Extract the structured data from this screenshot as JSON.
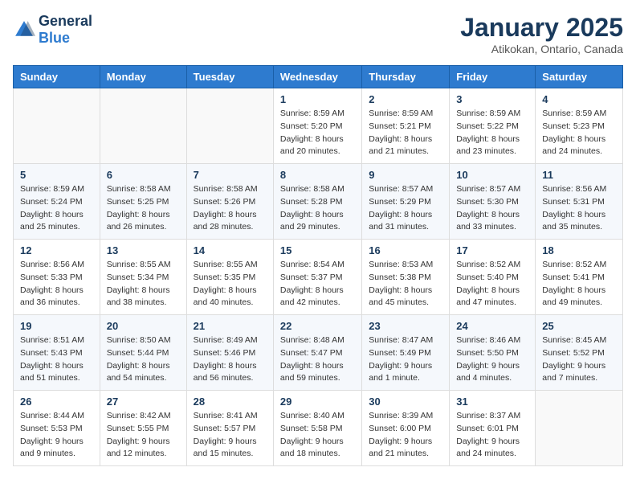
{
  "logo": {
    "general": "General",
    "blue": "Blue"
  },
  "header": {
    "title": "January 2025",
    "subtitle": "Atikokan, Ontario, Canada"
  },
  "weekdays": [
    "Sunday",
    "Monday",
    "Tuesday",
    "Wednesday",
    "Thursday",
    "Friday",
    "Saturday"
  ],
  "weeks": [
    [
      {
        "day": "",
        "sunrise": "",
        "sunset": "",
        "daylight": ""
      },
      {
        "day": "",
        "sunrise": "",
        "sunset": "",
        "daylight": ""
      },
      {
        "day": "",
        "sunrise": "",
        "sunset": "",
        "daylight": ""
      },
      {
        "day": "1",
        "sunrise": "Sunrise: 8:59 AM",
        "sunset": "Sunset: 5:20 PM",
        "daylight": "Daylight: 8 hours and 20 minutes."
      },
      {
        "day": "2",
        "sunrise": "Sunrise: 8:59 AM",
        "sunset": "Sunset: 5:21 PM",
        "daylight": "Daylight: 8 hours and 21 minutes."
      },
      {
        "day": "3",
        "sunrise": "Sunrise: 8:59 AM",
        "sunset": "Sunset: 5:22 PM",
        "daylight": "Daylight: 8 hours and 23 minutes."
      },
      {
        "day": "4",
        "sunrise": "Sunrise: 8:59 AM",
        "sunset": "Sunset: 5:23 PM",
        "daylight": "Daylight: 8 hours and 24 minutes."
      }
    ],
    [
      {
        "day": "5",
        "sunrise": "Sunrise: 8:59 AM",
        "sunset": "Sunset: 5:24 PM",
        "daylight": "Daylight: 8 hours and 25 minutes."
      },
      {
        "day": "6",
        "sunrise": "Sunrise: 8:58 AM",
        "sunset": "Sunset: 5:25 PM",
        "daylight": "Daylight: 8 hours and 26 minutes."
      },
      {
        "day": "7",
        "sunrise": "Sunrise: 8:58 AM",
        "sunset": "Sunset: 5:26 PM",
        "daylight": "Daylight: 8 hours and 28 minutes."
      },
      {
        "day": "8",
        "sunrise": "Sunrise: 8:58 AM",
        "sunset": "Sunset: 5:28 PM",
        "daylight": "Daylight: 8 hours and 29 minutes."
      },
      {
        "day": "9",
        "sunrise": "Sunrise: 8:57 AM",
        "sunset": "Sunset: 5:29 PM",
        "daylight": "Daylight: 8 hours and 31 minutes."
      },
      {
        "day": "10",
        "sunrise": "Sunrise: 8:57 AM",
        "sunset": "Sunset: 5:30 PM",
        "daylight": "Daylight: 8 hours and 33 minutes."
      },
      {
        "day": "11",
        "sunrise": "Sunrise: 8:56 AM",
        "sunset": "Sunset: 5:31 PM",
        "daylight": "Daylight: 8 hours and 35 minutes."
      }
    ],
    [
      {
        "day": "12",
        "sunrise": "Sunrise: 8:56 AM",
        "sunset": "Sunset: 5:33 PM",
        "daylight": "Daylight: 8 hours and 36 minutes."
      },
      {
        "day": "13",
        "sunrise": "Sunrise: 8:55 AM",
        "sunset": "Sunset: 5:34 PM",
        "daylight": "Daylight: 8 hours and 38 minutes."
      },
      {
        "day": "14",
        "sunrise": "Sunrise: 8:55 AM",
        "sunset": "Sunset: 5:35 PM",
        "daylight": "Daylight: 8 hours and 40 minutes."
      },
      {
        "day": "15",
        "sunrise": "Sunrise: 8:54 AM",
        "sunset": "Sunset: 5:37 PM",
        "daylight": "Daylight: 8 hours and 42 minutes."
      },
      {
        "day": "16",
        "sunrise": "Sunrise: 8:53 AM",
        "sunset": "Sunset: 5:38 PM",
        "daylight": "Daylight: 8 hours and 45 minutes."
      },
      {
        "day": "17",
        "sunrise": "Sunrise: 8:52 AM",
        "sunset": "Sunset: 5:40 PM",
        "daylight": "Daylight: 8 hours and 47 minutes."
      },
      {
        "day": "18",
        "sunrise": "Sunrise: 8:52 AM",
        "sunset": "Sunset: 5:41 PM",
        "daylight": "Daylight: 8 hours and 49 minutes."
      }
    ],
    [
      {
        "day": "19",
        "sunrise": "Sunrise: 8:51 AM",
        "sunset": "Sunset: 5:43 PM",
        "daylight": "Daylight: 8 hours and 51 minutes."
      },
      {
        "day": "20",
        "sunrise": "Sunrise: 8:50 AM",
        "sunset": "Sunset: 5:44 PM",
        "daylight": "Daylight: 8 hours and 54 minutes."
      },
      {
        "day": "21",
        "sunrise": "Sunrise: 8:49 AM",
        "sunset": "Sunset: 5:46 PM",
        "daylight": "Daylight: 8 hours and 56 minutes."
      },
      {
        "day": "22",
        "sunrise": "Sunrise: 8:48 AM",
        "sunset": "Sunset: 5:47 PM",
        "daylight": "Daylight: 8 hours and 59 minutes."
      },
      {
        "day": "23",
        "sunrise": "Sunrise: 8:47 AM",
        "sunset": "Sunset: 5:49 PM",
        "daylight": "Daylight: 9 hours and 1 minute."
      },
      {
        "day": "24",
        "sunrise": "Sunrise: 8:46 AM",
        "sunset": "Sunset: 5:50 PM",
        "daylight": "Daylight: 9 hours and 4 minutes."
      },
      {
        "day": "25",
        "sunrise": "Sunrise: 8:45 AM",
        "sunset": "Sunset: 5:52 PM",
        "daylight": "Daylight: 9 hours and 7 minutes."
      }
    ],
    [
      {
        "day": "26",
        "sunrise": "Sunrise: 8:44 AM",
        "sunset": "Sunset: 5:53 PM",
        "daylight": "Daylight: 9 hours and 9 minutes."
      },
      {
        "day": "27",
        "sunrise": "Sunrise: 8:42 AM",
        "sunset": "Sunset: 5:55 PM",
        "daylight": "Daylight: 9 hours and 12 minutes."
      },
      {
        "day": "28",
        "sunrise": "Sunrise: 8:41 AM",
        "sunset": "Sunset: 5:57 PM",
        "daylight": "Daylight: 9 hours and 15 minutes."
      },
      {
        "day": "29",
        "sunrise": "Sunrise: 8:40 AM",
        "sunset": "Sunset: 5:58 PM",
        "daylight": "Daylight: 9 hours and 18 minutes."
      },
      {
        "day": "30",
        "sunrise": "Sunrise: 8:39 AM",
        "sunset": "Sunset: 6:00 PM",
        "daylight": "Daylight: 9 hours and 21 minutes."
      },
      {
        "day": "31",
        "sunrise": "Sunrise: 8:37 AM",
        "sunset": "Sunset: 6:01 PM",
        "daylight": "Daylight: 9 hours and 24 minutes."
      },
      {
        "day": "",
        "sunrise": "",
        "sunset": "",
        "daylight": ""
      }
    ]
  ]
}
